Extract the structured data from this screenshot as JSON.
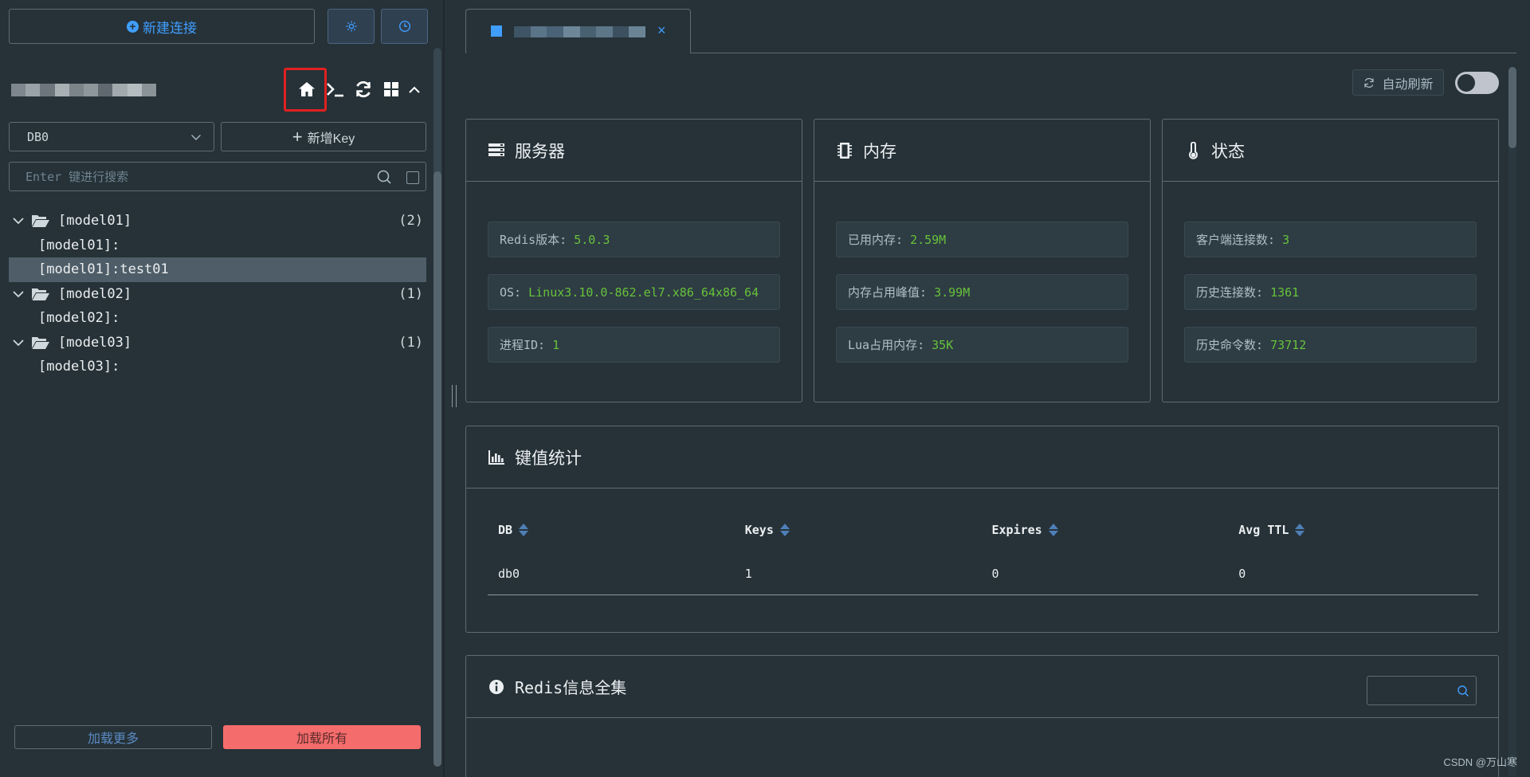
{
  "sidebar": {
    "new_connection_label": "新建连接",
    "db_select_value": "DB0",
    "add_key_label": "新增Key",
    "search_placeholder": "Enter 键进行搜索",
    "tree": [
      {
        "type": "folder",
        "label": "[model01]",
        "count": "(2)"
      },
      {
        "type": "leaf",
        "label": "[model01]:"
      },
      {
        "type": "leaf",
        "label": "[model01]:test01",
        "selected": true
      },
      {
        "type": "folder",
        "label": "[model02]",
        "count": "(1)"
      },
      {
        "type": "leaf",
        "label": "[model02]:"
      },
      {
        "type": "folder",
        "label": "[model03]",
        "count": "(1)"
      },
      {
        "type": "leaf",
        "label": "[model03]:"
      }
    ],
    "load_more_label": "加载更多",
    "load_all_label": "加载所有",
    "icons": [
      "home-icon",
      "terminal-icon",
      "refresh-icon",
      "grid-icon",
      "chevron-up-icon",
      "settings-icon",
      "clock-icon"
    ]
  },
  "tab": {
    "close": "×"
  },
  "toolbar": {
    "auto_refresh_label": "自动刷新",
    "auto_refresh_on": false
  },
  "server": {
    "title": "服务器",
    "rows": [
      {
        "label": "Redis版本:",
        "value": "5.0.3"
      },
      {
        "label": "OS:",
        "value": "Linux3.10.0-862.el7.x86_64x86_64"
      },
      {
        "label": "进程ID:",
        "value": "1"
      }
    ]
  },
  "memory": {
    "title": "内存",
    "rows": [
      {
        "label": "已用内存:",
        "value": "2.59M"
      },
      {
        "label": "内存占用峰值:",
        "value": "3.99M"
      },
      {
        "label": "Lua占用内存:",
        "value": "35K"
      }
    ]
  },
  "status": {
    "title": "状态",
    "rows": [
      {
        "label": "客户端连接数:",
        "value": "3"
      },
      {
        "label": "历史连接数:",
        "value": "1361"
      },
      {
        "label": "历史命令数:",
        "value": "73712"
      }
    ]
  },
  "keys": {
    "title": "键值统计",
    "columns": [
      "DB",
      "Keys",
      "Expires",
      "Avg TTL"
    ],
    "rows": [
      [
        "db0",
        "1",
        "0",
        "0"
      ]
    ]
  },
  "info": {
    "title": "Redis信息全集"
  },
  "colors": {
    "accent": "#409eff",
    "value_green": "#67c23a",
    "danger": "#f56c6c",
    "highlight_box": "#e02020"
  },
  "watermark": "CSDN @万山寒"
}
